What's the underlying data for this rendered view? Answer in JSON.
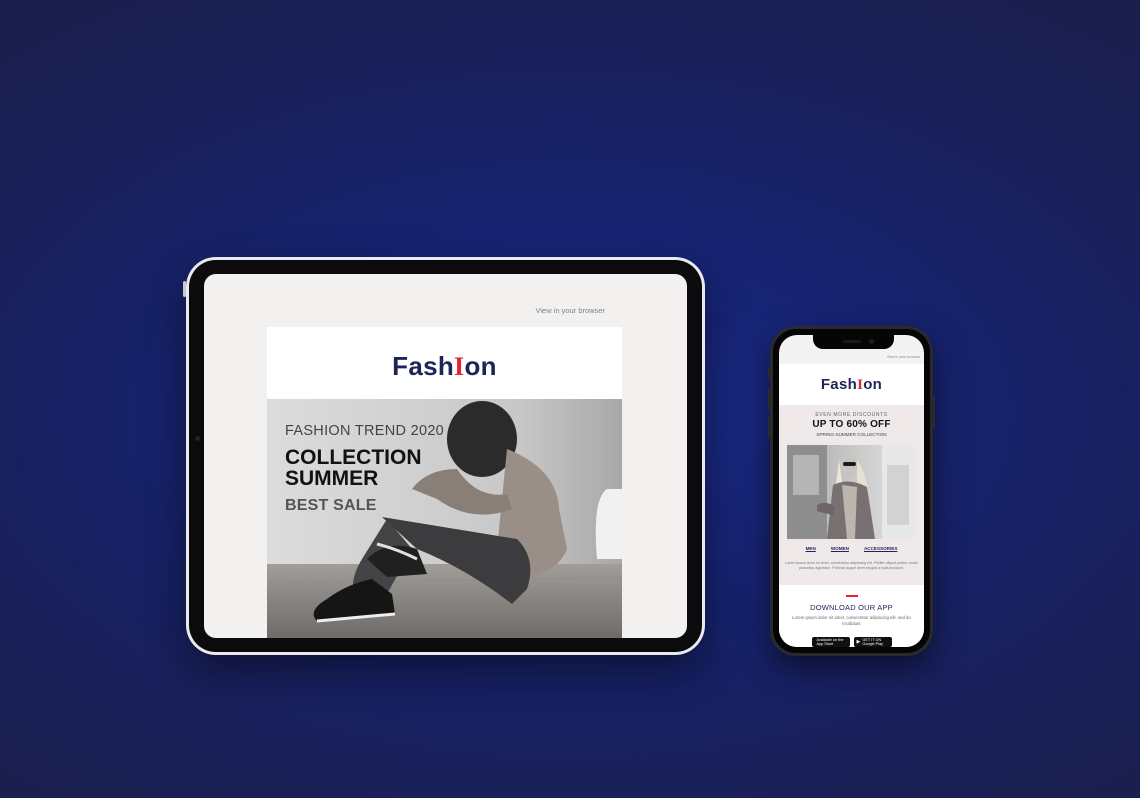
{
  "tablet": {
    "view_browser": "View in your browser",
    "logo_pre": "Fash",
    "logo_accent": "I",
    "logo_post": "on",
    "hero": {
      "trend": "FASHION TREND 2020",
      "collection_line1": "COLLECTION",
      "collection_line2": "SUMMER",
      "sale": "BEST SALE"
    }
  },
  "phone": {
    "view_browser": "View in your browser",
    "logo_pre": "Fash",
    "logo_accent": "I",
    "logo_post": "on",
    "promo": {
      "discounts": "EVEN MORE DISCOUNTS",
      "upto": "UP TO 60% OFF",
      "collection": "SPRING-SUMMER COLLECTION"
    },
    "nav": [
      "MEN",
      "WOMEN",
      "ACCESSORIES"
    ],
    "lorem1": "Lorem ipsum dolor sit amet, consectetur adipiscing elit. Phillfer aliquet porttor morbi phasellus dignissim. Pulvinar augue amet feugiat a nulla tincidunt.",
    "download_title": "DOWNLOAD OUR APP",
    "lorem2": "Lorem ipsum dolor sit amet, consectetur adipiscing elit, sed do incididunt",
    "app_store": "Available on the App Store",
    "google_play": "GET IT ON Google Play"
  },
  "colors": {
    "background": "#1a2a8a",
    "brand_navy": "#1f2458",
    "brand_red": "#e4262f"
  },
  "icons": [
    "apple-icon",
    "google-play-icon"
  ]
}
